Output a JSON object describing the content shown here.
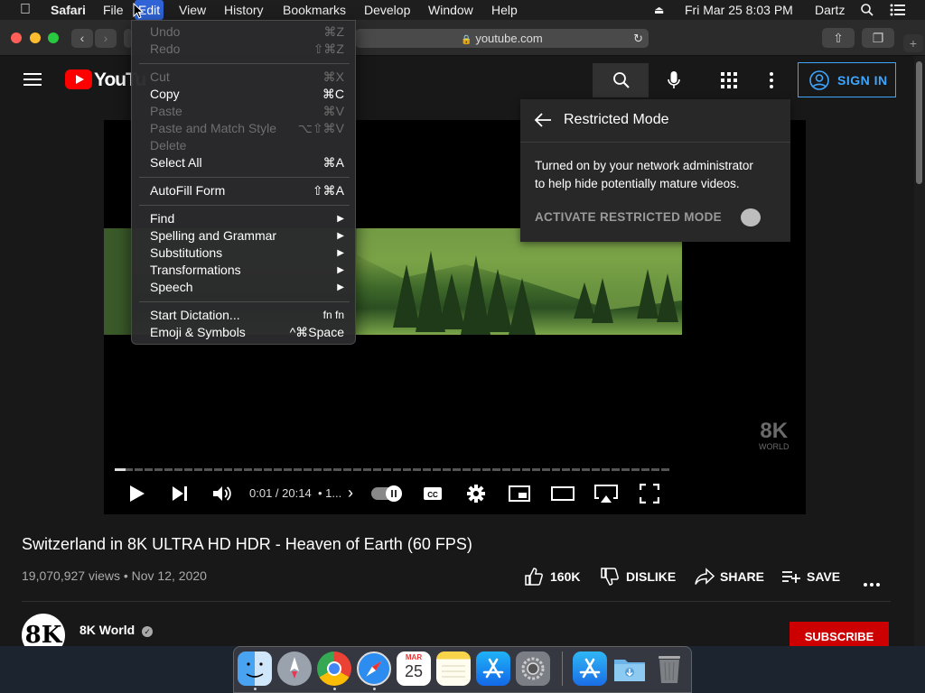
{
  "menubar": {
    "app": "Safari",
    "items": [
      "File",
      "Edit",
      "View",
      "History",
      "Bookmarks",
      "Develop",
      "Window",
      "Help"
    ],
    "clock": "Fri Mar 25  8:03 PM",
    "user": "Dartz"
  },
  "safari": {
    "address": "youtube.com"
  },
  "edit_menu": {
    "items": [
      {
        "label": "Undo",
        "shortcut": "⌘Z"
      },
      {
        "label": "Redo",
        "shortcut": "⇧⌘Z"
      },
      {
        "label": "Cut",
        "shortcut": "⌘X"
      },
      {
        "label": "Copy",
        "shortcut": "⌘C"
      },
      {
        "label": "Paste",
        "shortcut": "⌘V"
      },
      {
        "label": "Paste and Match Style",
        "shortcut": "⌥⇧⌘V"
      },
      {
        "label": "Delete",
        "shortcut": ""
      },
      {
        "label": "Select All",
        "shortcut": "⌘A"
      },
      {
        "label": "AutoFill Form",
        "shortcut": "⇧⌘A"
      },
      {
        "label": "Find",
        "shortcut": "▶"
      },
      {
        "label": "Spelling and Grammar",
        "shortcut": "▶"
      },
      {
        "label": "Substitutions",
        "shortcut": "▶"
      },
      {
        "label": "Transformations",
        "shortcut": "▶"
      },
      {
        "label": "Speech",
        "shortcut": "▶"
      },
      {
        "label": "Start Dictation...",
        "shortcut": "fn fn"
      },
      {
        "label": "Emoji & Symbols",
        "shortcut": "^⌘Space"
      }
    ]
  },
  "youtube": {
    "logo_text": "YouTu",
    "sign_in": "SIGN IN",
    "restricted": {
      "title": "Restricted Mode",
      "description_line1": "Turned on by your network administrator",
      "description_line2": "to help hide potentially mature videos.",
      "toggle_label": "ACTIVATE RESTRICTED MODE"
    },
    "player": {
      "time": "0:01 / 20:14",
      "chapter": "• 1...",
      "watermark_big": "8K",
      "watermark_small": "WORLD",
      "progress": 0.02
    },
    "video": {
      "title": "Switzerland in 8K ULTRA HD HDR - Heaven of Earth (60 FPS)",
      "views": "19,070,927 views",
      "date": "• Nov 12, 2020",
      "likes": "160K",
      "dislike": "DISLIKE",
      "share": "SHARE",
      "save": "SAVE"
    },
    "channel": {
      "logo": "8K",
      "name": "8K World",
      "subscribe": "SUBSCRIBE"
    }
  },
  "dock": {
    "calendar_month": "MAR",
    "calendar_day": "25"
  }
}
